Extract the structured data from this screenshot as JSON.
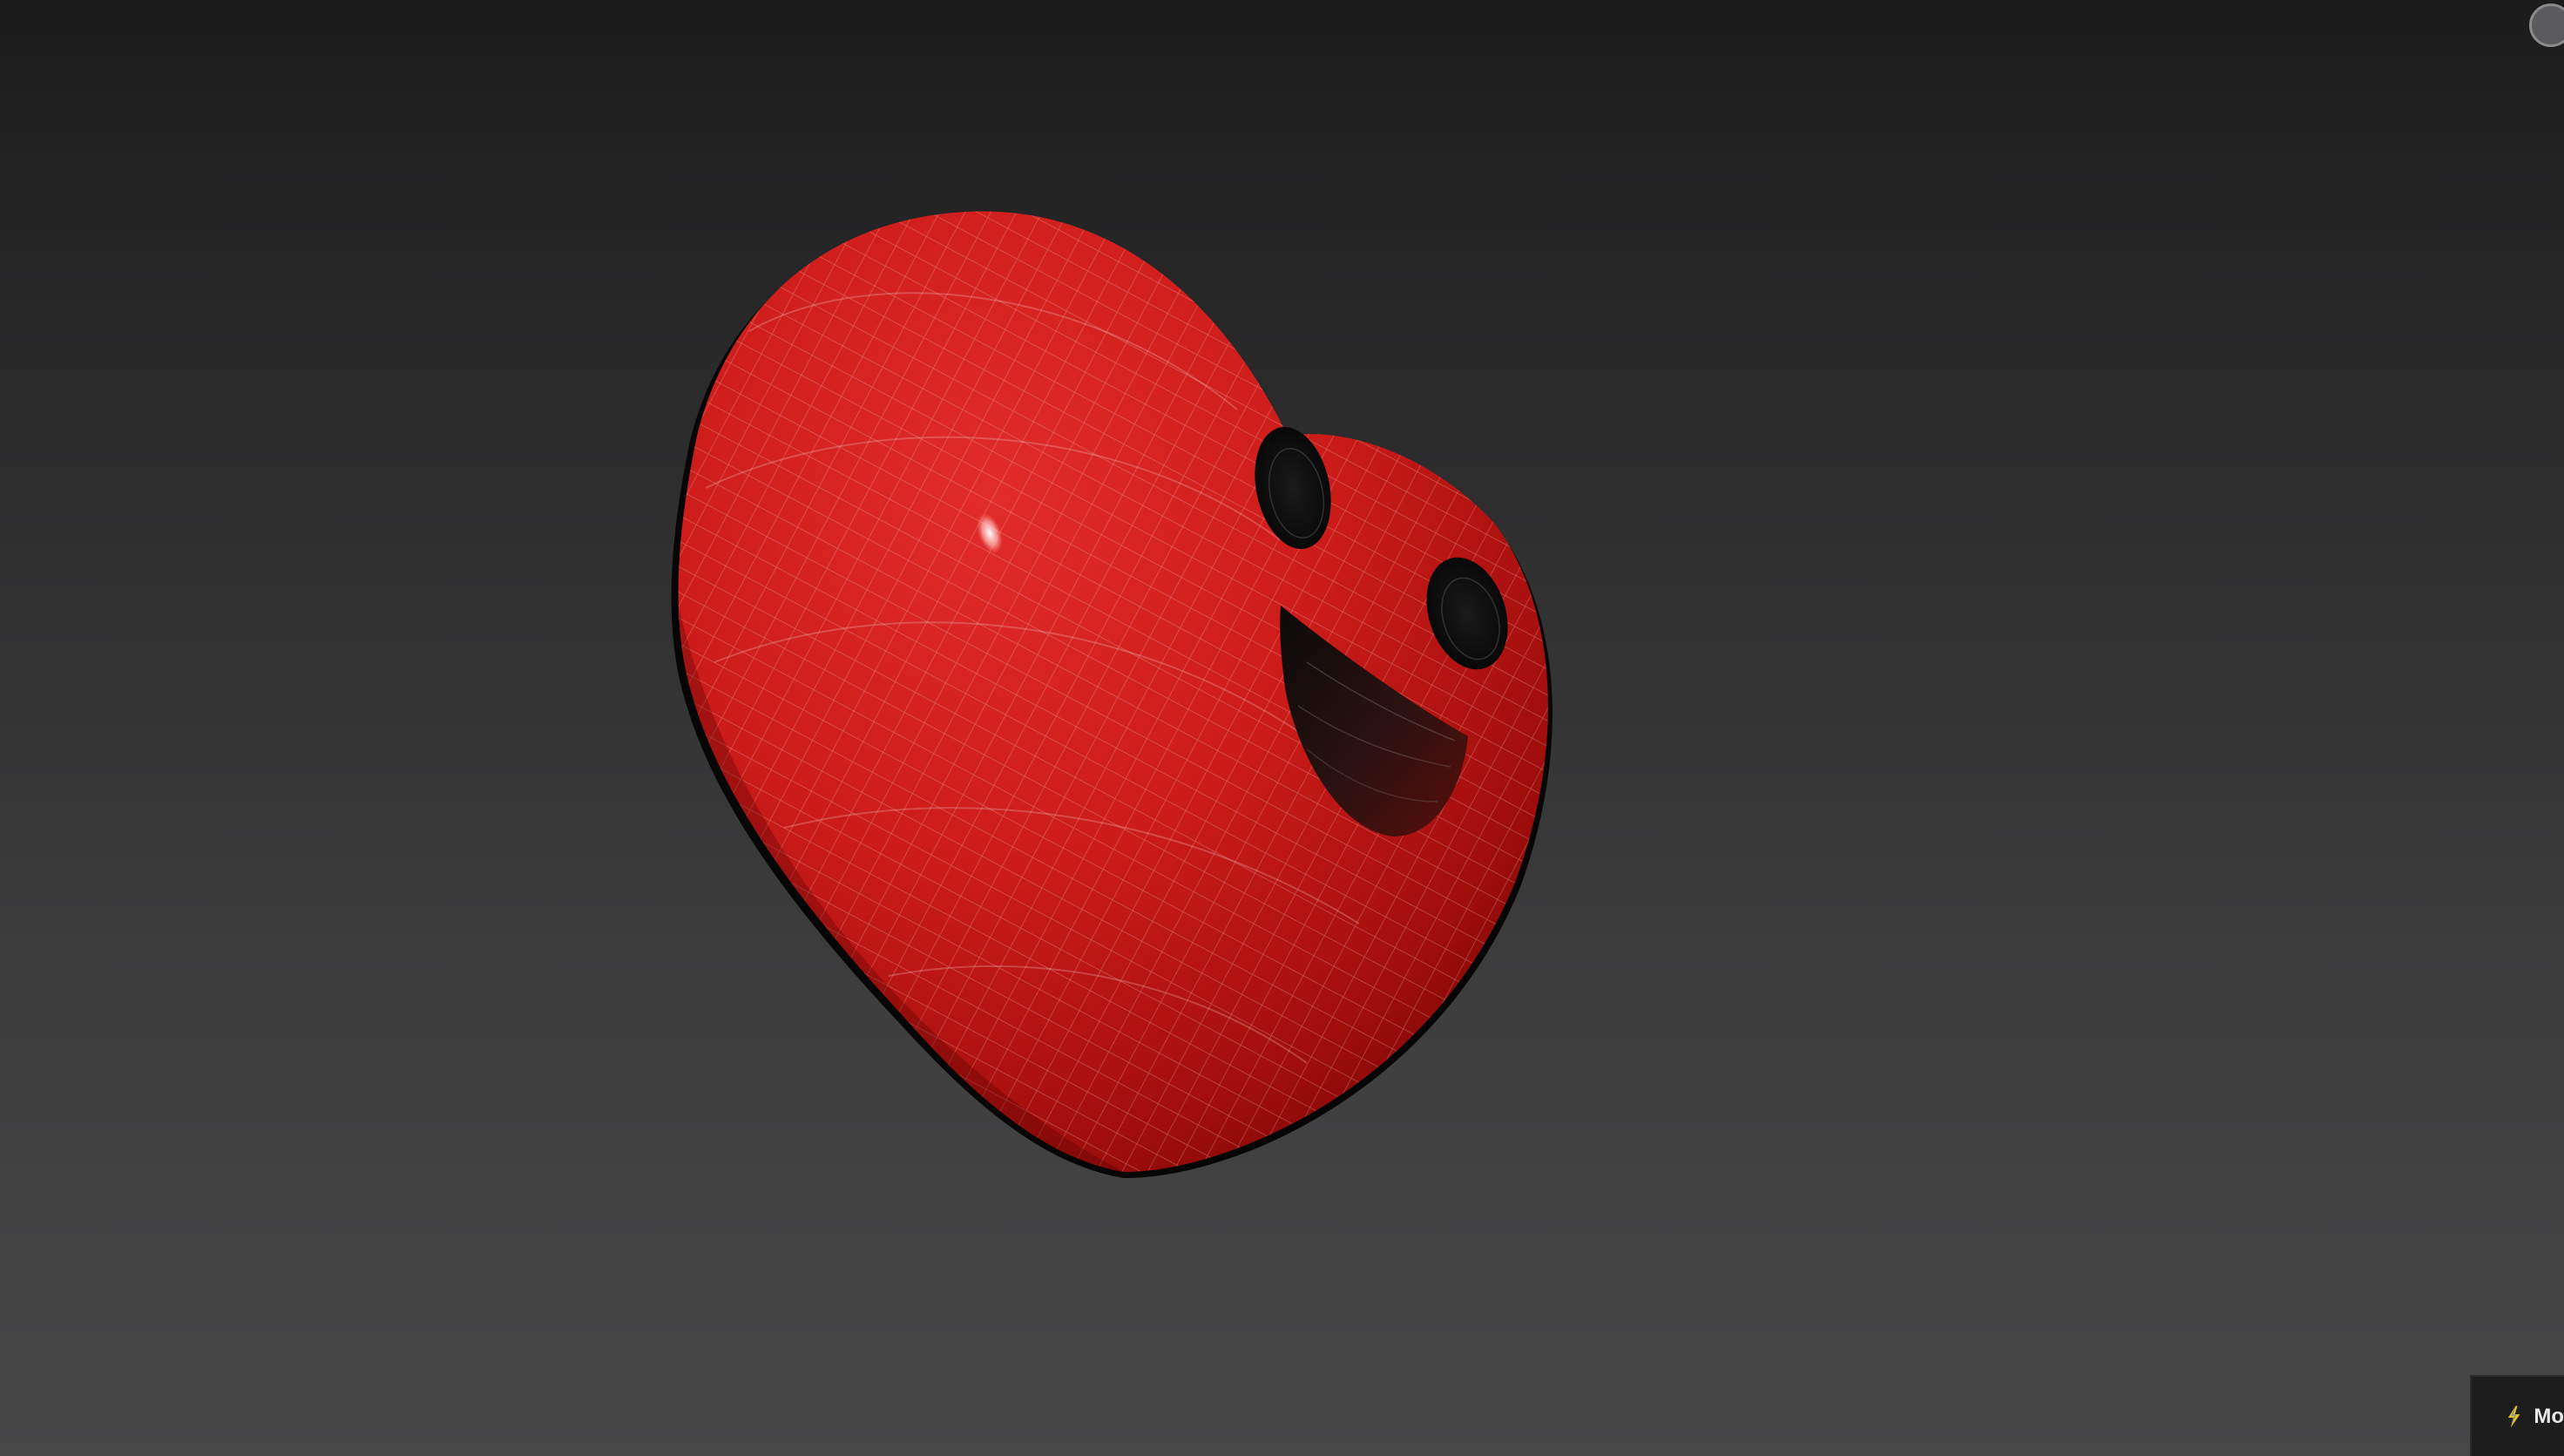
{
  "viewport": {
    "background_top": "#1b1b1c",
    "background_bottom": "#474748"
  },
  "model": {
    "body_color": "#d0201c",
    "shadow_color": "#7a0806",
    "wire_color": "#f2d6d4",
    "feature_color": "#0e0e0e"
  },
  "overlay": {
    "corner_icon": "navigation-gizmo-icon",
    "status_icon": "lightning-bolt-icon",
    "status_label": "Mo"
  }
}
